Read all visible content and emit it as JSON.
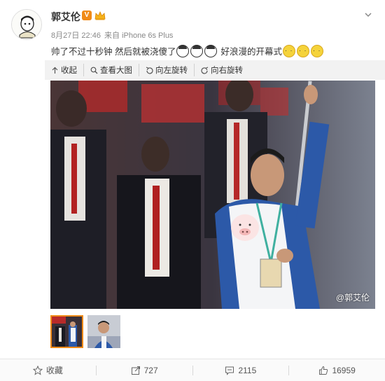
{
  "post": {
    "user_name": "郭艾伦",
    "verified_badge": "V",
    "date": "8月27日 22:46",
    "source": "来自 iPhone 6s Plus",
    "text_part1": "帅了不过十秒钟 然后就被浇傻了",
    "text_part2": "好浪漫的开幕式",
    "girl_emojis": 3,
    "cat_emojis": 3
  },
  "toolbar": {
    "collapse_label": "收起",
    "view_full_label": "查看大图",
    "rotate_left_label": "向左旋转",
    "rotate_right_label": "向右旋转"
  },
  "image": {
    "watermark": "@郭艾伦"
  },
  "actions": {
    "favorite_label": "收藏",
    "repost_count": "727",
    "comment_count": "2115",
    "like_count": "16959"
  },
  "colors": {
    "accent": "#f08a17",
    "toolbar_bg": "#f2f2f2",
    "text": "#333333",
    "meta": "#888888"
  },
  "icons": [
    "more-icon",
    "crown-icon",
    "collapse-icon",
    "magnifier-icon",
    "rotate-left-icon",
    "rotate-right-icon",
    "star-icon",
    "repost-icon",
    "comment-icon",
    "thumb-up-icon"
  ]
}
